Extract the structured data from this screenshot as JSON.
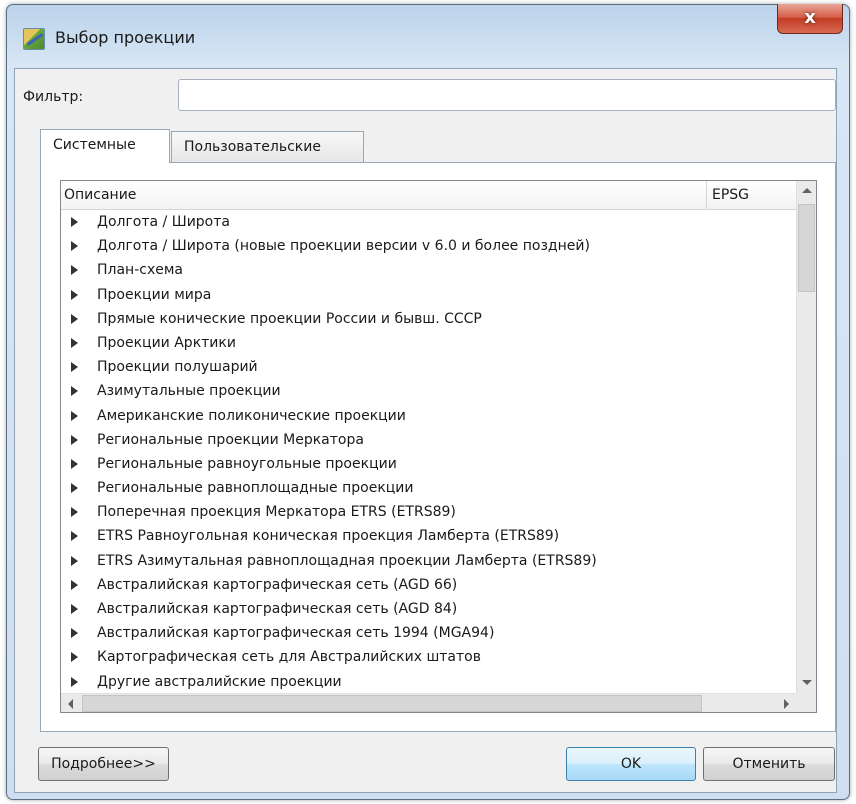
{
  "window": {
    "title": "Выбор проекции",
    "close_label": "x"
  },
  "filter": {
    "label": "Фильтр:",
    "value": "",
    "placeholder": ""
  },
  "tabs": [
    {
      "label": "Системные",
      "active": true
    },
    {
      "label": "Пользовательские",
      "active": false
    }
  ],
  "tree": {
    "columns": [
      "Описание",
      "EPSG"
    ],
    "rows": [
      "Долгота / Широта",
      "Долгота / Широта (новые проекции версии v 6.0 и более поздней)",
      "План-схема",
      "Проекции мира",
      "Прямые конические проекции России и бывш. СССР",
      "Проекции Арктики",
      "Проекции полушарий",
      "Азимутальные проекции",
      "Американские поликонические проекции",
      "Региональные проекции Меркатора",
      "Региональные равноугольные проекции",
      "Региональные равноплощадные проекции",
      "Поперечная проекция Меркатора ETRS (ETRS89)",
      "ETRS Равноугольная коническая проекция Ламберта (ETRS89)",
      "ETRS Азимутальная равноплощадная проекции Ламберта (ETRS89)",
      "Австралийская картографическая сеть (AGD 66)",
      "Австралийская картографическая сеть (AGD 84)",
      "Австралийская картографическая сеть 1994 (MGA94)",
      "Картографическая сеть для Австралийских штатов",
      "Другие австралийские проекции"
    ]
  },
  "buttons": {
    "more": "Подробнее>>",
    "ok": "OK",
    "cancel": "Отменить"
  },
  "colors": {
    "frame": "#c9dcef",
    "close": "#c23c23",
    "ok_button": "#bee6fd"
  }
}
